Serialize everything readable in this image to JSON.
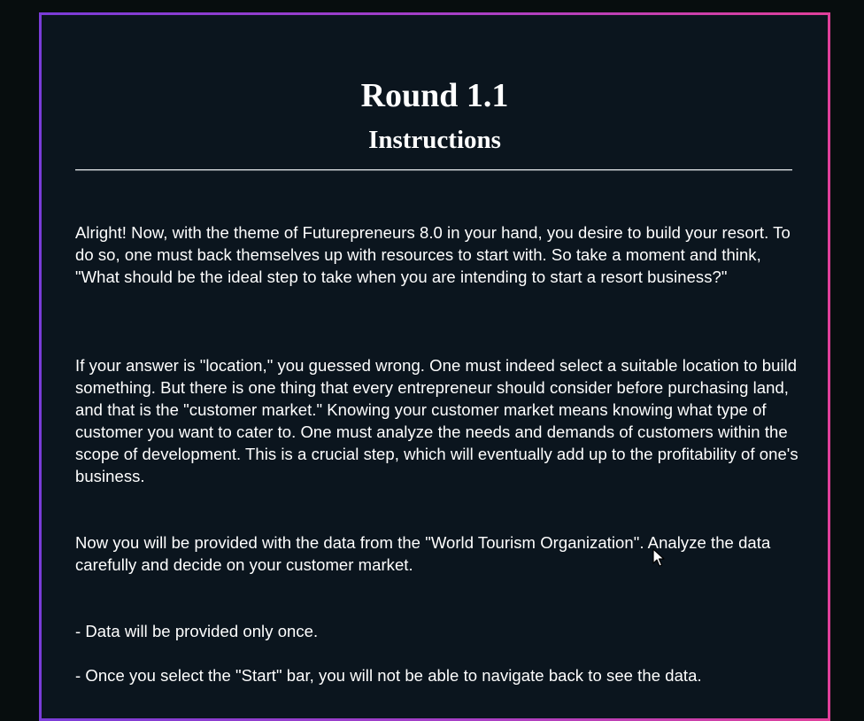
{
  "page": {
    "title": "Round 1.1",
    "subtitle": "Instructions",
    "paragraphs": [
      "Alright! Now, with the theme of Futurepreneurs 8.0 in your hand, you desire to build your resort. To do so, one must back themselves up with resources to start with. So take a moment and think, \"What should be the ideal step to take when you are intending to start a resort business?\"",
      "If your answer is \"location,\" you guessed wrong. One must indeed select a suitable location to build something. But there is one thing that every entrepreneur should consider before purchasing land, and that is the \"customer market.\" Knowing your customer market means knowing what type of customer you want to cater to. One must analyze the needs and demands of customers within the scope of development. This is a crucial step, which will eventually add up to the profitability of one's business.",
      "Now you will be provided with the data from the \"World Tourism Organization\". Analyze the data carefully and decide on your customer market."
    ],
    "bullets": [
      "- Data will be provided only once.",
      "- Once you select the \"Start\" bar, you will not be able to navigate back to see the data."
    ]
  },
  "colors": {
    "background": "#070d0e",
    "panel": "#0b151e",
    "border_start": "#7a3cd8",
    "border_end": "#e13f9a",
    "text": "#ffffff"
  },
  "icons": {
    "cursor": "mouse-pointer-icon"
  }
}
